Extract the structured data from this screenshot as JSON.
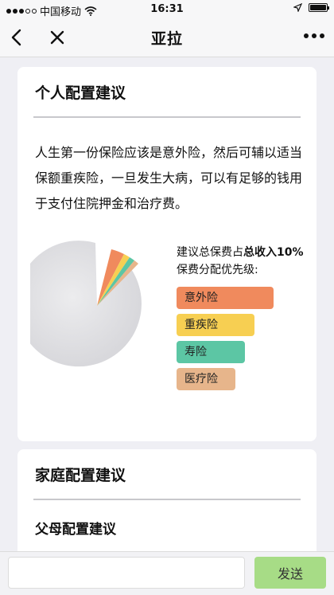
{
  "status_bar": {
    "carrier": "中国移动",
    "time": "16:31",
    "icons": [
      "signal-dots-icon",
      "wifi-icon",
      "location-arrow-icon",
      "battery-icon"
    ]
  },
  "nav": {
    "title": "亚拉",
    "icons": [
      "back-chevron-icon",
      "close-icon",
      "more-icon"
    ]
  },
  "card1": {
    "title": "个人配置建议",
    "body": "人生第一份保险应该是意外险，然后可辅以适当保额重疾险，一旦发生大病，可以有足够的钱用于支付住院押金和治疗费。",
    "legend_line1_prefix": "建议总保费占",
    "legend_line1_bold": "总收入10%",
    "legend_line2": "保费分配优先级:",
    "priorities": [
      "意外险",
      "重疾险",
      "寿险",
      "医疗险"
    ],
    "priority_colors": [
      "#f08a5d",
      "#f7cf52",
      "#5cc6a4",
      "#e7b58b"
    ]
  },
  "card2": {
    "title": "家庭配置建议",
    "subtitle": "父母配置建议"
  },
  "input_bar": {
    "placeholder": "",
    "send_label": "发送"
  }
}
